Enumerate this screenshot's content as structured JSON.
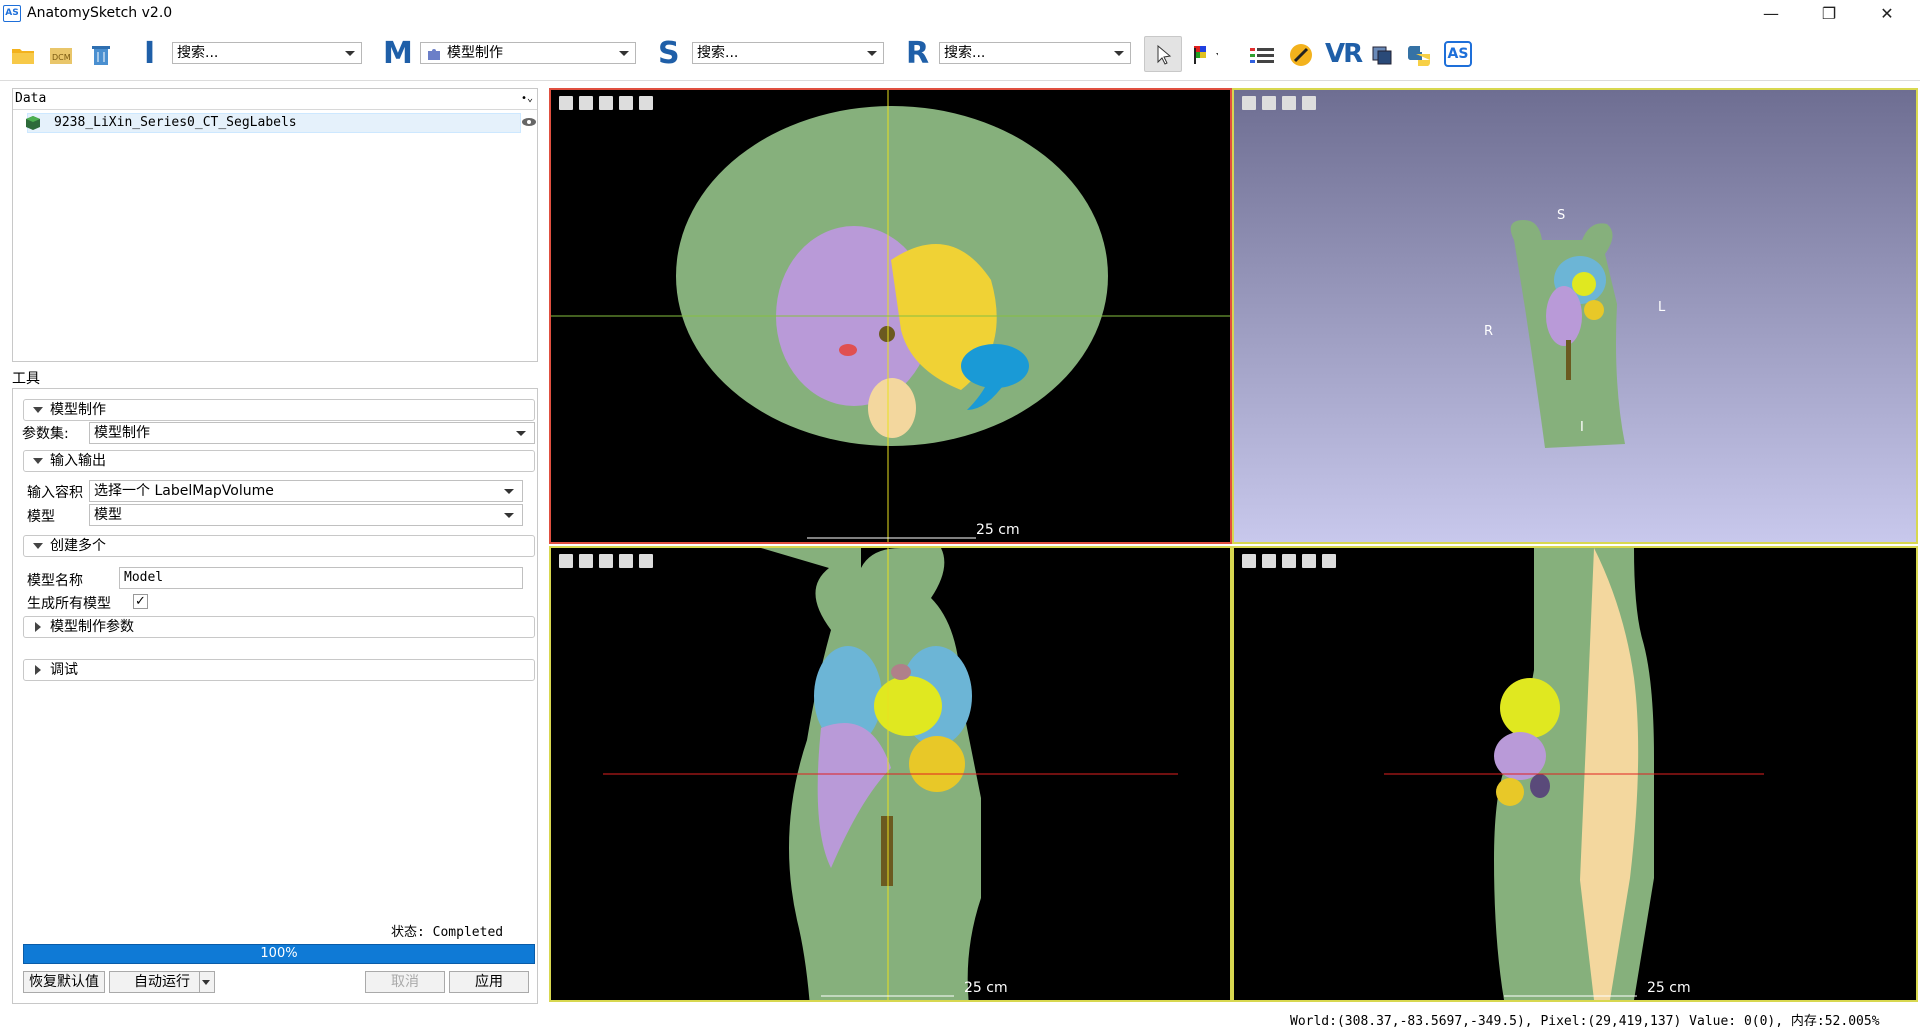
{
  "window": {
    "logo_text": "AS",
    "title": "AnatomySketch v2.0",
    "minimize": "—",
    "restore": "❐",
    "close": "✕"
  },
  "toolbar": {
    "letters": {
      "i": "I",
      "m": "M",
      "s": "S",
      "r": "R"
    },
    "search_i": "搜索...",
    "search_m": "模型制作",
    "search_s": "搜索...",
    "search_r": "搜索...",
    "vr_label": "VR",
    "as_label": "AS"
  },
  "data_panel": {
    "header": "Data",
    "items": [
      {
        "label": "9238_LiXin_Series0_CT_SegLabels"
      }
    ]
  },
  "tools": {
    "title": "工具",
    "model_section": "模型制作",
    "param_set_label": "参数集:",
    "param_set_value": "模型制作",
    "io_section": "输入输出",
    "input_volume_label": "输入容积",
    "input_volume_value": "选择一个 LabelMapVolume",
    "model_label": "模型",
    "model_value": "模型",
    "create_section": "创建多个",
    "model_name_label": "模型名称",
    "model_name_value": "Model",
    "generate_all_label": "生成所有模型",
    "generate_all_checked": "✓",
    "params_section": "模型制作参数",
    "debug_section": "调试",
    "status_text": "状态: Completed",
    "progress_text": "100%",
    "progress_value": 1.0,
    "restore_button": "恢复默认值",
    "auto_run_button": "自动运行",
    "cancel_button": "取消",
    "apply_button": "应用"
  },
  "views": {
    "axial_scale": "25 cm",
    "coronal_scale": "25 cm",
    "sagittal_scale": "25 cm",
    "orient_s": "S",
    "orient_i": "I",
    "orient_r": "R",
    "orient_l": "L"
  },
  "status_bar": "World:(308.37,-83.5697,-349.5), Pixel:(29,419,137) Value: 0(0), 内存:52.005%",
  "colors": {
    "body": "#86b07c",
    "liver": "#b99ad8",
    "stomach": "#f0d235",
    "spleen": "#1a9ad6",
    "bone": "#f3d79e",
    "lung": "#6cb5d6",
    "heart": "#e0e820",
    "kidney": "#e8c828",
    "axial_border": "#e05040",
    "view_border": "#d8d850",
    "crosshair_y": "#e8e020",
    "crosshair_r": "#e02020"
  }
}
